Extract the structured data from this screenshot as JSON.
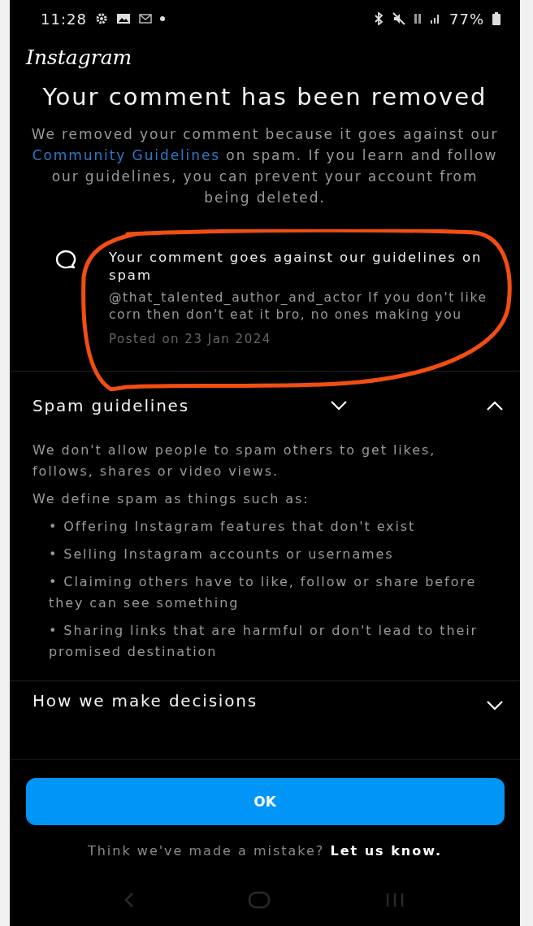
{
  "status_bar": {
    "time": "11:28",
    "battery": "77%"
  },
  "app_logo": "Instagram",
  "title": "Your comment has been removed",
  "description": {
    "before": "We removed your comment because it goes against our ",
    "link": "Community Guidelines",
    "after": " on spam. If you learn and follow our guidelines, you can prevent your account from being deleted."
  },
  "comment": {
    "heading": "Your comment goes against our guidelines on spam",
    "text": "@that_talented_author_and_actor If you don't like corn then don't eat it bro, no ones making you",
    "posted": "Posted on 23 Jan 2024"
  },
  "sections": [
    {
      "title": "Spam guidelines",
      "expanded": true,
      "paragraphs": [
        "We don't allow people to spam others to get likes, follows, shares or video views.",
        "We define spam as things such as:"
      ],
      "bullets": [
        "• Offering Instagram features that don't exist",
        "• Selling Instagram accounts or usernames",
        "• Claiming others have to like, follow or share before they can see something",
        "• Sharing links that are harmful or don't lead to their promised destination"
      ]
    },
    {
      "title": "How we make decisions",
      "expanded": false
    }
  ],
  "ok_button": "OK",
  "footer": {
    "text": "Think we've made a mistake? ",
    "link": "Let us know."
  }
}
